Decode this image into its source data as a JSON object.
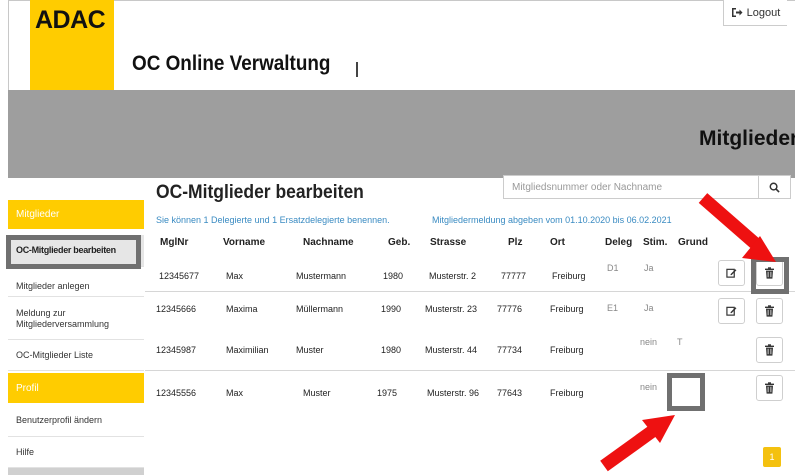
{
  "header": {
    "logo_text": "ADAC",
    "app_title": "OC Online Verwaltung",
    "logout_label": "Logout",
    "page_heading": "Mitglieder"
  },
  "sidebar": {
    "items": [
      {
        "label": "Mitglieder",
        "type": "section"
      },
      {
        "label": "OC-Mitglieder bearbeiten",
        "type": "link",
        "active": true
      },
      {
        "label": "Mitglieder anlegen",
        "type": "link"
      },
      {
        "label": "Meldung zur Mitgliederversammlung",
        "type": "link"
      },
      {
        "label": "OC-Mitglieder Liste",
        "type": "link"
      },
      {
        "label": "Profil",
        "type": "section"
      },
      {
        "label": "Benutzerprofil ändern",
        "type": "link"
      },
      {
        "label": "Hilfe",
        "type": "link"
      }
    ]
  },
  "main": {
    "title": "OC-Mitglieder bearbeiten",
    "search_placeholder": "Mitgliedsnummer oder Nachname",
    "info_left": "Sie können 1 Delegierte und 1 Ersatzdelegierte benennen.",
    "info_right": "Mitgliedermeldung abgeben vom 01.10.2020 bis 06.02.2021",
    "columns": [
      "MglNr",
      "Vorname",
      "Nachname",
      "Geb.",
      "Strasse",
      "Plz",
      "Ort",
      "Deleg",
      "Stim.",
      "Grund"
    ],
    "rows": [
      {
        "mglnr": "12345677",
        "vorname": "Max",
        "nachname": "Mustermann",
        "geb": "1980",
        "strasse": "Musterstr. 2",
        "plz": "77777",
        "ort": "Freiburg",
        "deleg": "D1",
        "stim": "Ja",
        "grund": ""
      },
      {
        "mglnr": "12345666",
        "vorname": "Maxima",
        "nachname": "Müllermann",
        "geb": "1990",
        "strasse": "Musterstr. 23",
        "plz": "77776",
        "ort": "Freiburg",
        "deleg": "E1",
        "stim": "Ja",
        "grund": ""
      },
      {
        "mglnr": "12345987",
        "vorname": "Maximilian",
        "nachname": "Muster",
        "geb": "1980",
        "strasse": "Musterstr. 44",
        "plz": "77734",
        "ort": "Freiburg",
        "deleg": "",
        "stim": "nein",
        "grund": "T"
      },
      {
        "mglnr": "12345556",
        "vorname": "Max",
        "nachname": "Muster",
        "geb": "1975",
        "strasse": "Musterstr. 96",
        "plz": "77643",
        "ort": "Freiburg",
        "deleg": "",
        "stim": "nein",
        "grund": ""
      }
    ]
  },
  "pagination": {
    "current_page": "1"
  },
  "icons": {
    "logout": "sign-out-icon",
    "search": "search-icon",
    "edit": "edit-icon",
    "delete": "trash-icon"
  },
  "colors": {
    "brand_yellow": "#ffcc00",
    "header_band": "#9e9e9e",
    "info_text": "#3a8bc2",
    "annotation_red": "#ee1111",
    "annotation_outline": "#707070",
    "pagination": "#f4c10f"
  }
}
